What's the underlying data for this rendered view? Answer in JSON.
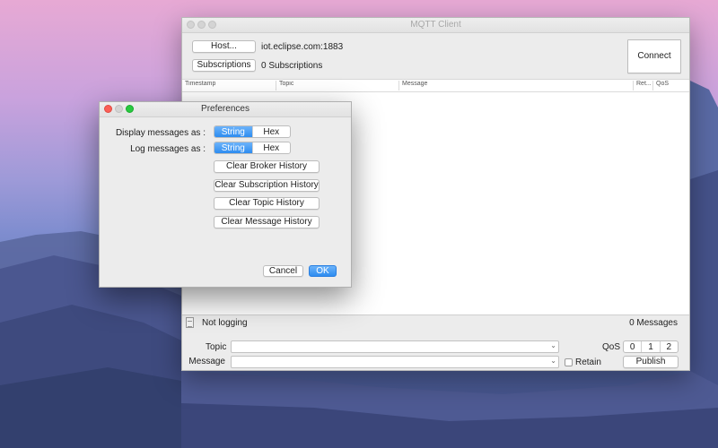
{
  "main_window": {
    "title": "MQTT Client",
    "host_button": "Host...",
    "host_value": "iot.eclipse.com:1883",
    "subscriptions_button": "Subscriptions",
    "subscriptions_count": "0 Subscriptions",
    "connect_button": "Connect",
    "table": {
      "columns": [
        "Timestamp",
        "Topic",
        "Message",
        "Ret...",
        "QoS"
      ],
      "rows": []
    },
    "status": {
      "logging": "Not logging",
      "messages_count": "0 Messages"
    },
    "publish_form": {
      "topic_label": "Topic",
      "topic_value": "",
      "message_label": "Message",
      "message_value": "",
      "qos_label": "QoS",
      "qos_options": [
        "0",
        "1",
        "2"
      ],
      "retain_label": "Retain",
      "retain_checked": false,
      "publish_button": "Publish"
    }
  },
  "preferences": {
    "title": "Preferences",
    "display_label": "Display messages as :",
    "display_options": [
      "String",
      "Hex"
    ],
    "display_selected": "String",
    "log_label": "Log messages as :",
    "log_options": [
      "String",
      "Hex"
    ],
    "log_selected": "String",
    "clear_broker": "Clear Broker History",
    "clear_subscription": "Clear Subscription History",
    "clear_topic": "Clear Topic History",
    "clear_message": "Clear Message History",
    "cancel_button": "Cancel",
    "ok_button": "OK"
  },
  "colors": {
    "accent": "#2d8cf0",
    "window_bg": "#ececec",
    "close": "#fc5f57",
    "minimize": "#fdbd2e",
    "zoom": "#28c940"
  },
  "icons": {
    "log_file": "document-icon",
    "dropdown": "chevron-down-icon"
  }
}
